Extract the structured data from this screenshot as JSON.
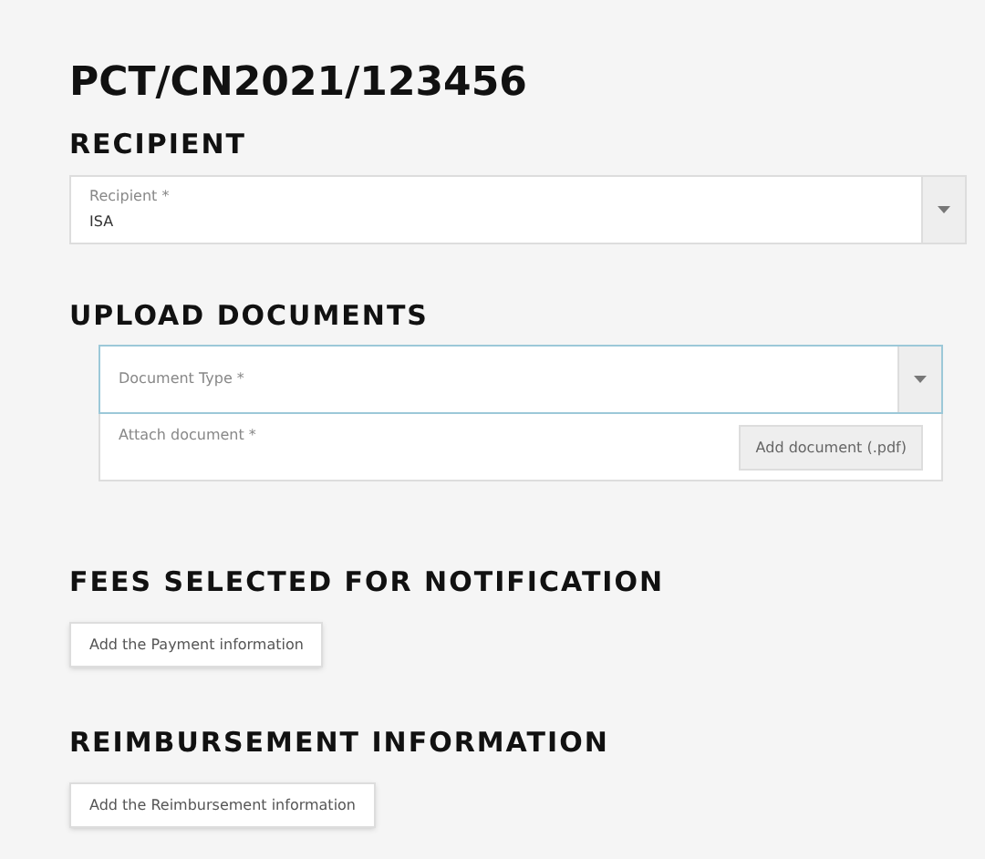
{
  "title": "PCT/CN2021/123456",
  "recipient": {
    "heading": "RECIPIENT",
    "field": {
      "label": "Recipient *",
      "value": "ISA",
      "focused": false
    }
  },
  "upload": {
    "heading": "UPLOAD DOCUMENTS",
    "document_type": {
      "label": "Document Type *",
      "focused": true
    },
    "attach": {
      "label": "Attach document *",
      "button": "Add document (.pdf)"
    }
  },
  "fees": {
    "heading": "FEES SELECTED FOR NOTIFICATION",
    "button": "Add the Payment information"
  },
  "reimbursement": {
    "heading": "REIMBURSEMENT INFORMATION",
    "button": "Add the Reimbursement information"
  }
}
